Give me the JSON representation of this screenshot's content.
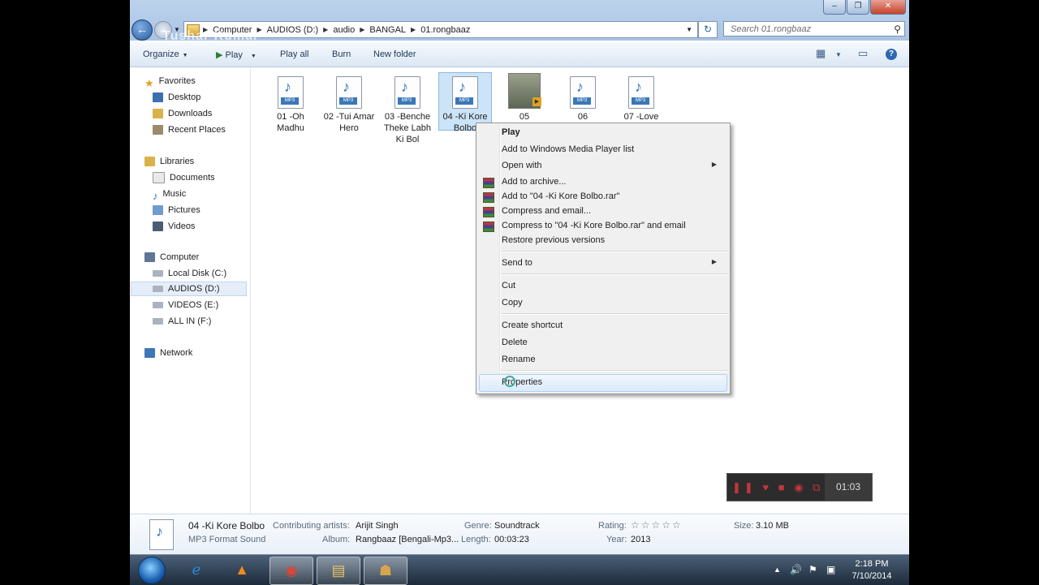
{
  "address": {
    "crumbs": [
      "Computer",
      "AUDIOS (D:)",
      "audio",
      "BANGAL",
      "01.rongbaaz"
    ],
    "search_placeholder": "Search 01.rongbaaz",
    "overlay_text": "Tushar Kumar"
  },
  "toolbar": {
    "organize": "Organize",
    "play": "Play",
    "play_all": "Play all",
    "burn": "Burn",
    "new_folder": "New folder"
  },
  "nav": {
    "favorites": "Favorites",
    "desktop": "Desktop",
    "downloads": "Downloads",
    "recent_places": "Recent Places",
    "libraries": "Libraries",
    "documents": "Documents",
    "music": "Music",
    "pictures": "Pictures",
    "videos": "Videos",
    "computer": "Computer",
    "local_disk": "Local Disk (C:)",
    "audios": "AUDIOS (D:)",
    "videos_drive": "VIDEOS (E:)",
    "all_in": "ALL IN (F:)",
    "network": "Network"
  },
  "files": [
    {
      "label": "01 -Oh Madhu",
      "icon": "mp3-file-icon"
    },
    {
      "label": "02 -Tui Amar Hero",
      "icon": "mp3-file-icon"
    },
    {
      "label": "03 -Benche Theke Labh Ki Bol",
      "icon": "mp3-file-icon"
    },
    {
      "label": "04 -Ki Kore Bolbo",
      "icon": "mp3-file-icon"
    },
    {
      "label": "05",
      "icon": "video-thumbnail-icon"
    },
    {
      "label": "06",
      "icon": "mp3-file-icon"
    },
    {
      "label": "07 -Love",
      "icon": "mp3-file-icon"
    }
  ],
  "file_labels": {
    "f1": "01 -Oh Madhu",
    "f2": "02 -Tui Amar Hero",
    "f3": "03 -Benche Theke Labh Ki Bol",
    "f4": "04 -Ki Kore Bolbo",
    "f5": "05",
    "f6": "06",
    "f7": "07 -Love"
  },
  "menu": {
    "play": "Play",
    "add_wmp": "Add to Windows Media Player list",
    "open_with": "Open with",
    "add_archive": "Add to archive...",
    "add_rar": "Add to \"04 -Ki Kore Bolbo.rar\"",
    "compress_email": "Compress and email...",
    "compress_rar_email": "Compress to \"04 -Ki Kore Bolbo.rar\" and email",
    "restore": "Restore previous versions",
    "send_to": "Send to",
    "cut": "Cut",
    "copy": "Copy",
    "create_shortcut": "Create shortcut",
    "delete": "Delete",
    "rename": "Rename",
    "properties": "Properties"
  },
  "details": {
    "title": "04 -Ki Kore Bolbo",
    "type": "MP3 Format Sound",
    "artists_label": "Contributing artists:",
    "artists": "Arijit Singh",
    "album_label": "Album:",
    "album": "Rangbaaz [Bengali-Mp3...",
    "genre_label": "Genre:",
    "genre": "Soundtrack",
    "length_label": "Length:",
    "length": "00:03:23",
    "rating_label": "Rating:",
    "rating_stars": "☆☆☆☆☆",
    "year_label": "Year:",
    "year": "2013",
    "size_label": "Size:",
    "size": "3.10 MB"
  },
  "recorder": {
    "time": "01:03"
  },
  "taskbar": {
    "time": "2:18 PM",
    "date": "7/10/2014"
  },
  "colors": {
    "accent": "#2872b7",
    "selection": "#cce4f7",
    "menu_bg": "#f0f0f0"
  }
}
